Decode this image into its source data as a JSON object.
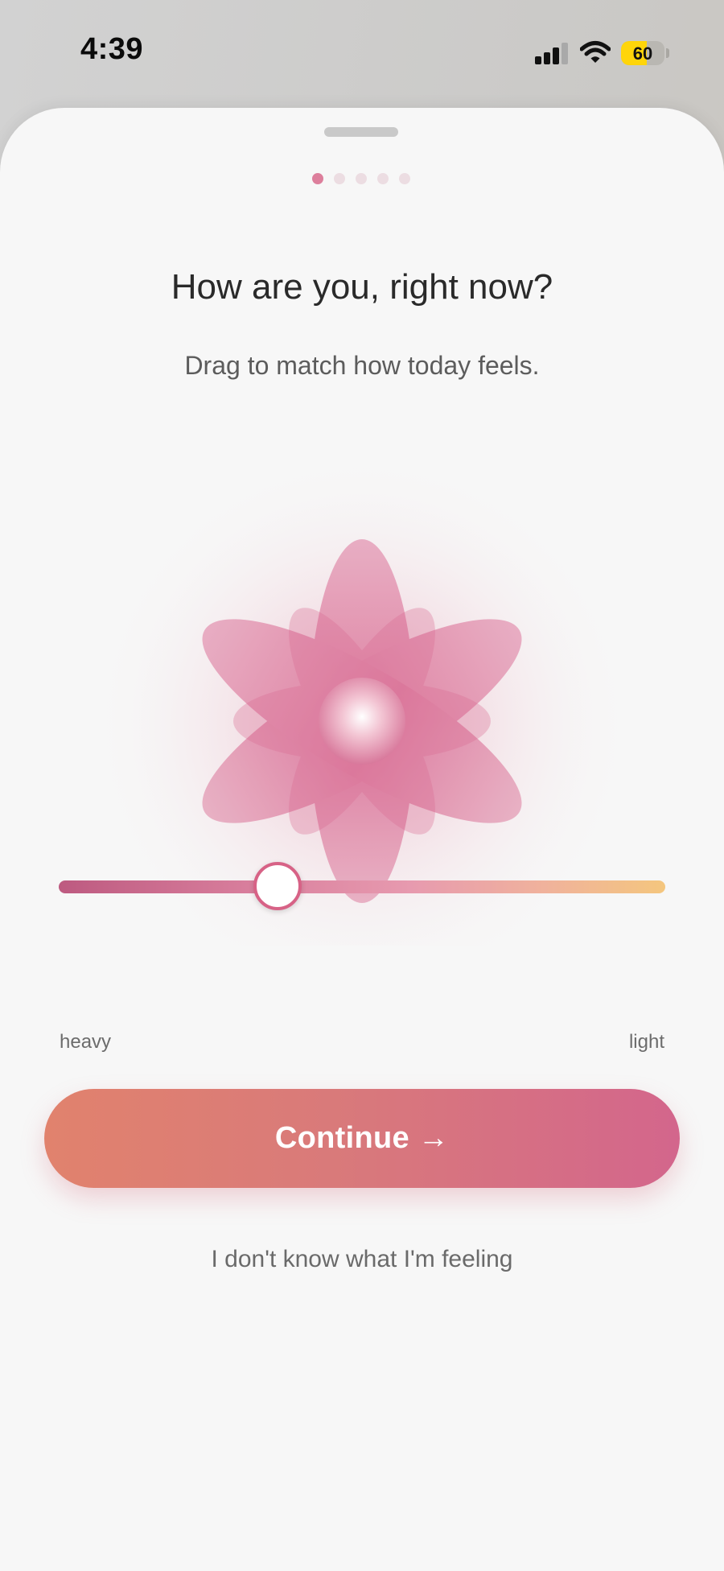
{
  "status_bar": {
    "time": "4:39",
    "battery_level": "60",
    "battery_fraction": 0.6,
    "battery_color": "#ffd50a",
    "icons": [
      "cellular-signal-icon",
      "wifi-icon",
      "battery-icon"
    ]
  },
  "sheet": {
    "page_count": 5,
    "active_page": 1
  },
  "question": {
    "title": "How are you, right now?",
    "subtitle": "Drag to match how today feels."
  },
  "mood_slider": {
    "value_fraction": 0.36,
    "min_label": "heavy",
    "max_label": "light",
    "gradient_colors": [
      "#bd5a80",
      "#d97f9d",
      "#e79aaf",
      "#f0b29c",
      "#f4c67e"
    ]
  },
  "flower": {
    "icon": "flower-icon",
    "petal_color": "#d96a92"
  },
  "actions": {
    "continue_label": "Continue →",
    "skip_label": "I don't know what I'm feeling"
  },
  "colors": {
    "accent": "#d76286",
    "button_start": "#e1826d",
    "button_end": "#d3668c",
    "sheet_background": "#f7f7f7"
  }
}
